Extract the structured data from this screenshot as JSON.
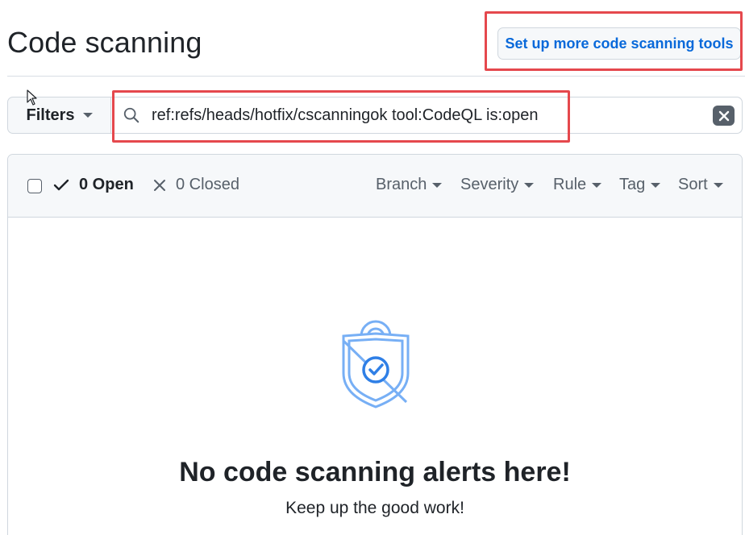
{
  "header": {
    "title": "Code scanning",
    "setup_button_label": "Set up more code scanning tools"
  },
  "filter_bar": {
    "filters_label": "Filters",
    "search_value": "ref:refs/heads/hotfix/cscanningok tool:CodeQL is:open",
    "search_icon": "search-icon",
    "clear_icon": "x-circle-icon"
  },
  "alerts_header": {
    "open_label": "0 Open",
    "closed_label": "0 Closed",
    "dropdowns": {
      "branch": "Branch",
      "severity": "Severity",
      "rule": "Rule",
      "tag": "Tag",
      "sort": "Sort"
    }
  },
  "empty_state": {
    "icon": "shield-check-icon",
    "title": "No code scanning alerts here!",
    "subtitle": "Keep up the good work!"
  },
  "colors": {
    "accent": "#0969da",
    "highlight": "#e5484d",
    "icon_blue": "#77aff5"
  }
}
